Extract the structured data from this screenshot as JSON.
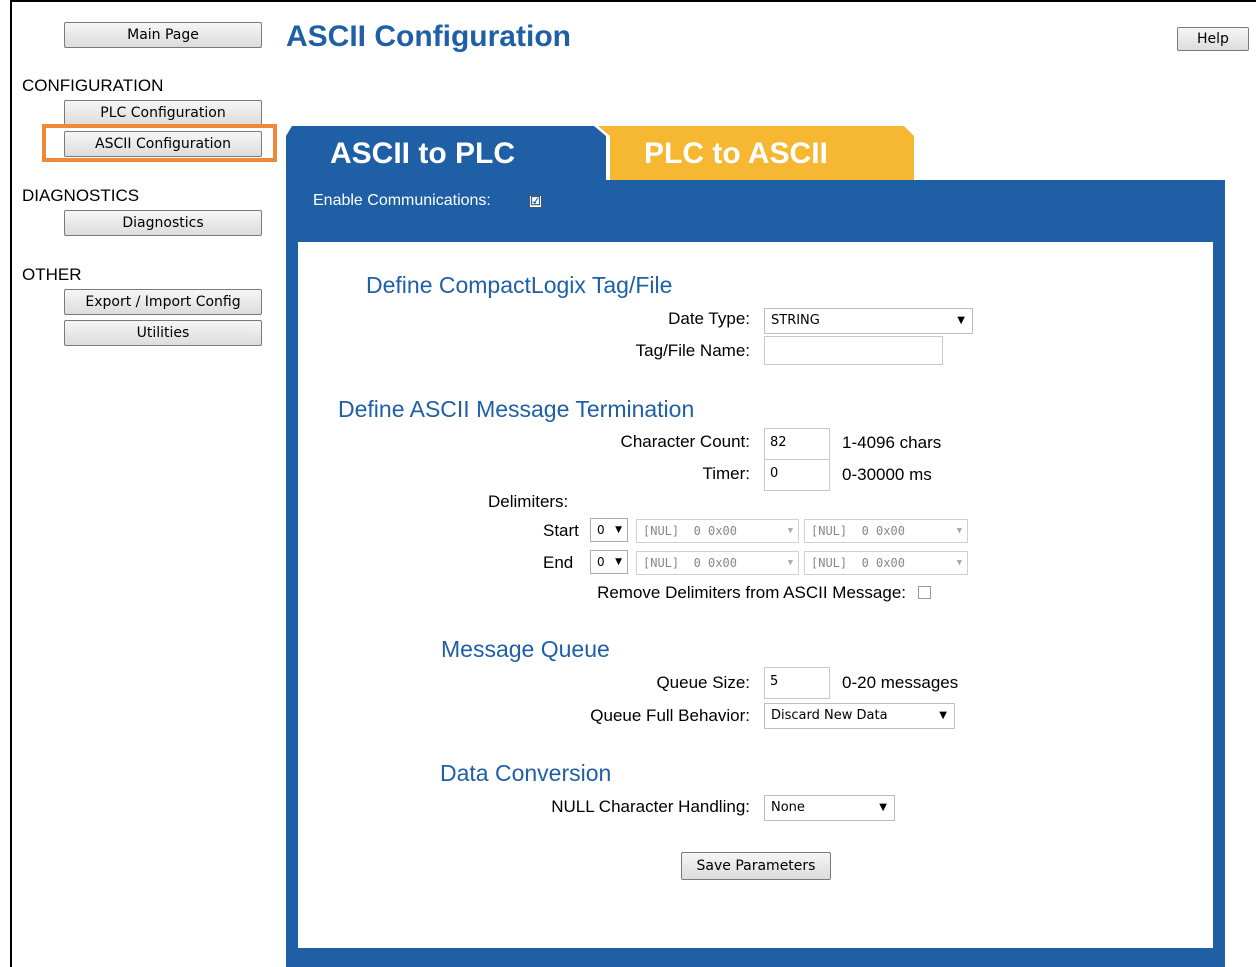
{
  "sidebar": {
    "main_page": "Main Page",
    "config_section": "CONFIGURATION",
    "plc_config": "PLC Configuration",
    "ascii_config": "ASCII Configuration",
    "diag_section": "DIAGNOSTICS",
    "diagnostics": "Diagnostics",
    "other_section": "OTHER",
    "export_import": "Export / Import Config",
    "utilities": "Utilities"
  },
  "header": {
    "title": "ASCII Configuration",
    "help": "Help"
  },
  "tabs": {
    "active": "ASCII to PLC",
    "inactive": "PLC to ASCII"
  },
  "enable": {
    "label": "Enable Communications:",
    "checked": true,
    "glyph": "☑"
  },
  "tag": {
    "heading": "Define CompactLogix Tag/File",
    "data_type_label": "Date Type:",
    "data_type_value": "STRING",
    "name_label": "Tag/File Name:",
    "name_value": ""
  },
  "termination": {
    "heading": "Define ASCII Message Termination",
    "char_count_label": "Character Count:",
    "char_count_value": "82",
    "char_count_unit": "1-4096 chars",
    "timer_label": "Timer:",
    "timer_value": "0",
    "timer_unit": "0-30000 ms",
    "delimiters_label": "Delimiters:",
    "start_label": "Start",
    "start_count": "0",
    "end_label": "End",
    "end_count": "0",
    "delim_value": "[NUL]  0 0x00",
    "remove_label": "Remove Delimiters from ASCII Message:"
  },
  "queue": {
    "heading": "Message Queue",
    "size_label": "Queue Size:",
    "size_value": "5",
    "size_unit": "0-20 messages",
    "full_label": "Queue Full Behavior:",
    "full_value": "Discard New Data"
  },
  "conversion": {
    "heading": "Data Conversion",
    "null_label": "NULL Character Handling:",
    "null_value": "None"
  },
  "save": "Save Parameters",
  "colors": {
    "accent": "#1f5fa6",
    "tab_inactive": "#f6b732",
    "highlight": "#f0883a"
  }
}
